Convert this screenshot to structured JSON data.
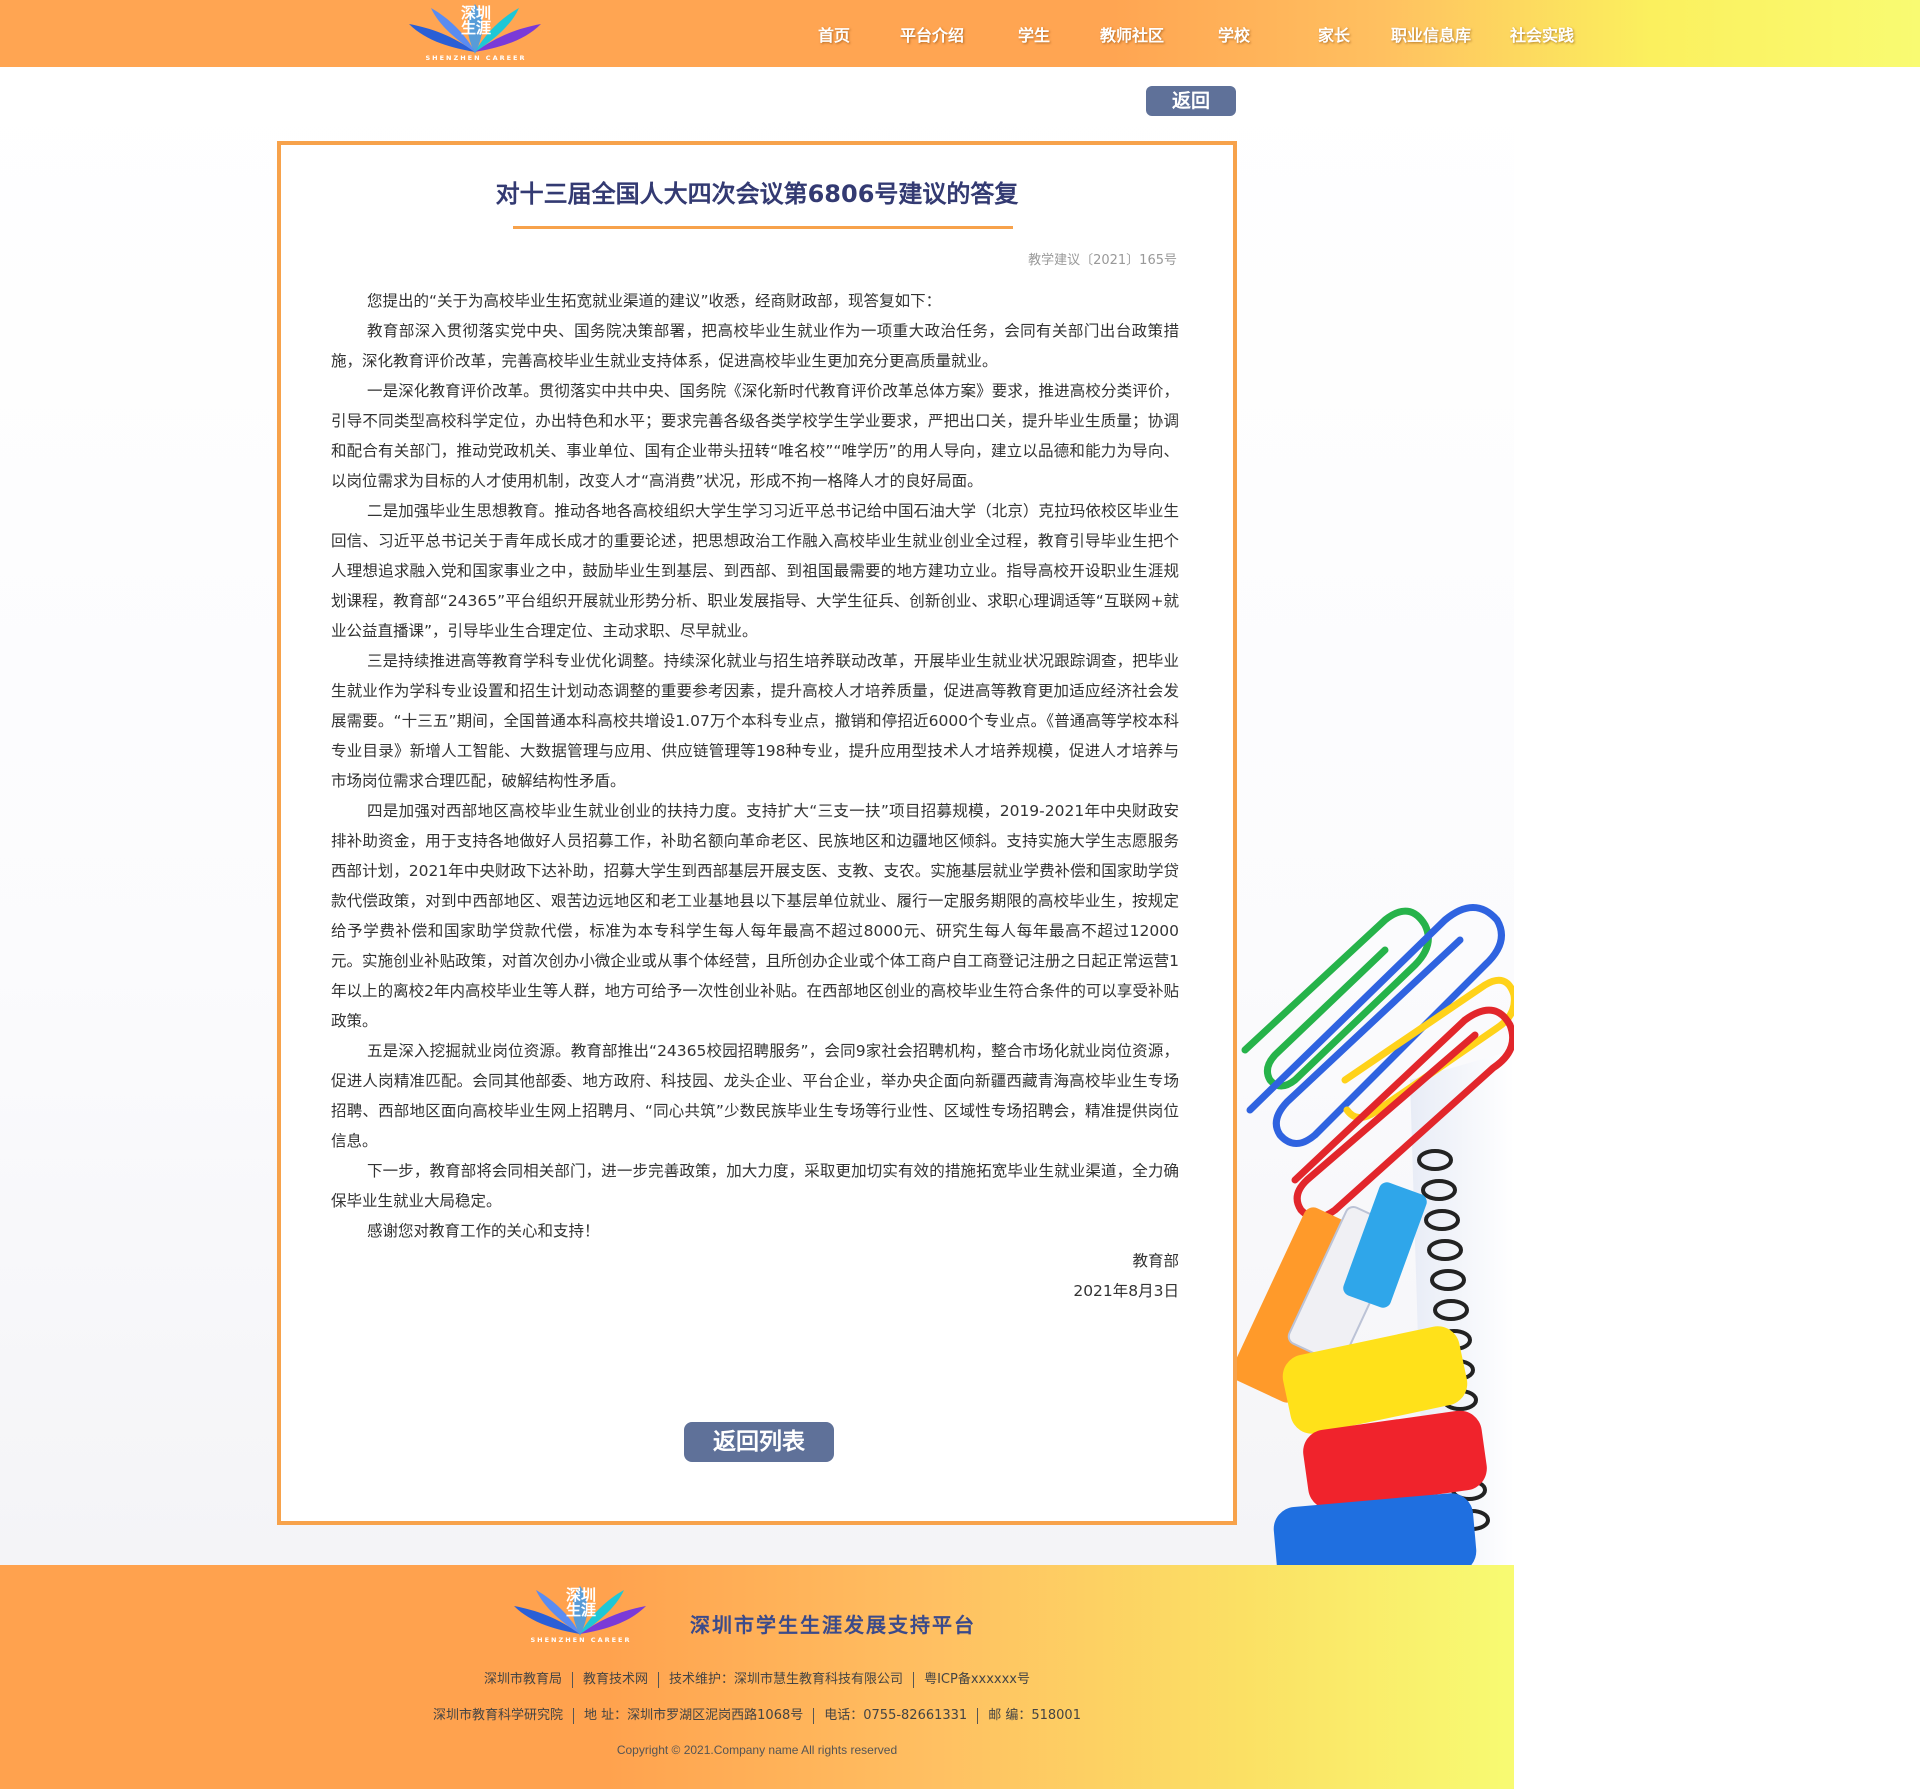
{
  "header": {
    "logo": {
      "text_line1": "深圳",
      "text_line2": "生涯",
      "subtitle": "SHENZHEN CAREER"
    },
    "nav": [
      "首页",
      "平台介绍",
      "学生",
      "教师社区",
      "学校",
      "家长",
      "职业信息库",
      "社会实践"
    ]
  },
  "main": {
    "back_label": "返回",
    "title": "对十三届全国人大四次会议第6806号建议的答复",
    "doc_no": "教学建议〔2021〕165号",
    "paragraphs": [
      "您提出的“关于为高校毕业生拓宽就业渠道的建议”收悉，经商财政部，现答复如下：",
      "教育部深入贯彻落实党中央、国务院决策部署，把高校毕业生就业作为一项重大政治任务，会同有关部门出台政策措施，深化教育评价改革，完善高校毕业生就业支持体系，促进高校毕业生更加充分更高质量就业。",
      "一是深化教育评价改革。贯彻落实中共中央、国务院《深化新时代教育评价改革总体方案》要求，推进高校分类评价，引导不同类型高校科学定位，办出特色和水平；要求完善各级各类学校学生学业要求，严把出口关，提升毕业生质量；协调和配合有关部门，推动党政机关、事业单位、国有企业带头扭转“唯名校”“唯学历”的用人导向，建立以品德和能力为导向、以岗位需求为目标的人才使用机制，改变人才“高消费”状况，形成不拘一格降人才的良好局面。",
      "二是加强毕业生思想教育。推动各地各高校组织大学生学习习近平总书记给中国石油大学（北京）克拉玛依校区毕业生回信、习近平总书记关于青年成长成才的重要论述，把思想政治工作融入高校毕业生就业创业全过程，教育引导毕业生把个人理想追求融入党和国家事业之中，鼓励毕业生到基层、到西部、到祖国最需要的地方建功立业。指导高校开设职业生涯规划课程，教育部“24365”平台组织开展就业形势分析、职业发展指导、大学生征兵、创新创业、求职心理调适等“互联网+就业公益直播课”，引导毕业生合理定位、主动求职、尽早就业。",
      "三是持续推进高等教育学科专业优化调整。持续深化就业与招生培养联动改革，开展毕业生就业状况跟踪调查，把毕业生就业作为学科专业设置和招生计划动态调整的重要参考因素，提升高校人才培养质量，促进高等教育更加适应经济社会发展需要。“十三五”期间，全国普通本科高校共增设1.07万个本科专业点，撤销和停招近6000个专业点。《普通高等学校本科专业目录》新增人工智能、大数据管理与应用、供应链管理等198种专业，提升应用型技术人才培养规模，促进人才培养与市场岗位需求合理匹配，破解结构性矛盾。",
      "四是加强对西部地区高校毕业生就业创业的扶持力度。支持扩大“三支一扶”项目招募规模，2019-2021年中央财政安排补助资金，用于支持各地做好人员招募工作，补助名额向革命老区、民族地区和边疆地区倾斜。支持实施大学生志愿服务西部计划，2021年中央财政下达补助，招募大学生到西部基层开展支医、支教、支农。实施基层就业学费补偿和国家助学贷款代偿政策，对到中西部地区、艰苦边远地区和老工业基地县以下基层单位就业、履行一定服务期限的高校毕业生，按规定给予学费补偿和国家助学贷款代偿，标准为本专科学生每人每年最高不超过8000元、研究生每人每年最高不超过12000元。实施创业补贴政策，对首次创办小微企业或从事个体经营，且所创办企业或个体工商户自工商登记注册之日起正常运营1年以上的离校2年内高校毕业生等人群，地方可给予一次性创业补贴。在西部地区创业的高校毕业生符合条件的可以享受补贴政策。",
      "五是深入挖掘就业岗位资源。教育部推出“24365校园招聘服务”，会同9家社会招聘机构，整合市场化就业岗位资源，促进人岗精准匹配。会同其他部委、地方政府、科技园、龙头企业、平台企业，举办央企面向新疆西藏青海高校毕业生专场招聘、西部地区面向高校毕业生网上招聘月、“同心共筑”少数民族毕业生专场等行业性、区域性专场招聘会，精准提供岗位信息。",
      "下一步，教育部将会同相关部门，进一步完善政策，加大力度，采取更加切实有效的措施拓宽毕业生就业渠道，全力确保毕业生就业大局稳定。",
      "感谢您对教育工作的关心和支持！"
    ],
    "signature_org": "教育部",
    "signature_date": "2021年8月3日",
    "list_button_label": "返回列表"
  },
  "footer": {
    "logo": {
      "text_line1": "深圳",
      "text_line2": "生涯",
      "subtitle": "SHENZHEN CAREER"
    },
    "platform_name": "深圳市学生生涯发展支持平台",
    "row1": [
      "深圳市教育局",
      "教育技术网",
      "技术维护：深圳市慧生教育科技有限公司",
      "粤ICP备xxxxxx号"
    ],
    "row2": [
      "深圳市教育科学研究院",
      "地  址：深圳市罗湖区泥岗西路1068号",
      "电话：0755-82661331",
      "邮  编：518001"
    ],
    "copyright": "Copyright © 2021.Company name All rights reserved"
  },
  "colors": {
    "header_orange": "#ffa552",
    "header_yellow": "#f9fb72",
    "accent_border": "#f7a24b",
    "button_blue": "#5f7199",
    "title_navy": "#333a72"
  }
}
